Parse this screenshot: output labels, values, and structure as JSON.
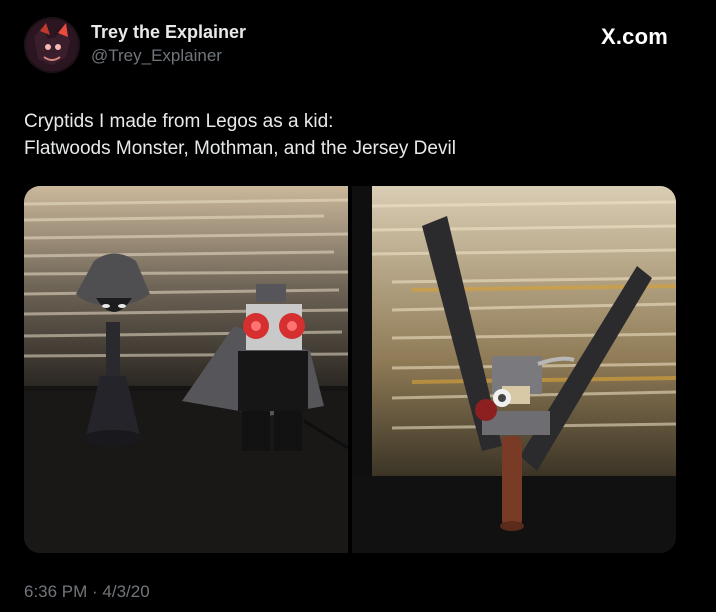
{
  "author": {
    "name": "Trey the Explainer",
    "handle": "@Trey_Explainer"
  },
  "brand": {
    "label": "X.com"
  },
  "tweet": {
    "line1": "Cryptids I made from Legos as a kid:",
    "line2": "Flatwoods Monster, Mothman, and the Jersey Devil"
  },
  "meta": {
    "timestamp": "6:36 PM · 4/3/20"
  },
  "colors": {
    "background": "#000000",
    "primary_text": "#e7e9ea",
    "secondary_text": "#71767b"
  }
}
